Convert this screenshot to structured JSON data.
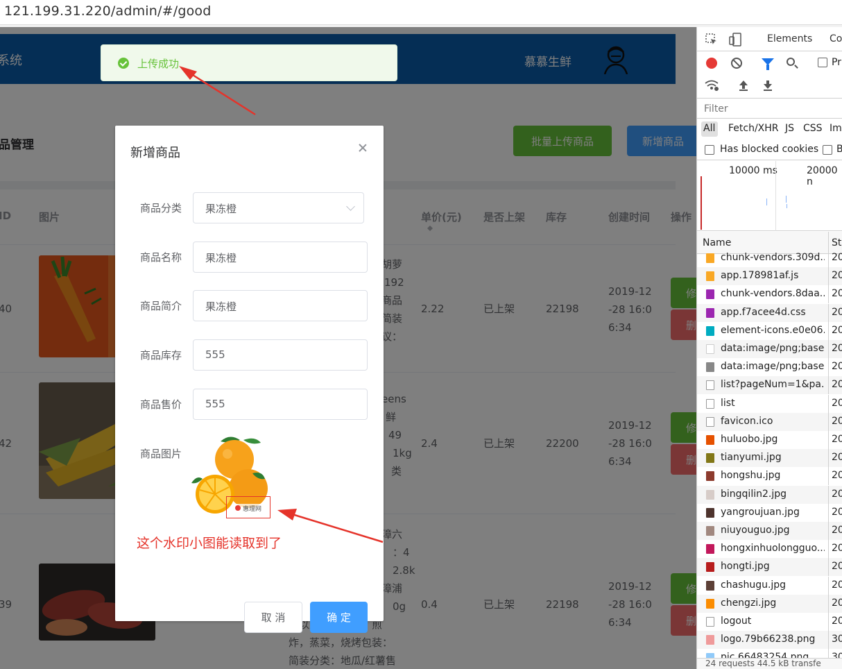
{
  "browser": {
    "url": "121.199.31.220/admin/#/good"
  },
  "header": {
    "system_partial": "系统",
    "username": "慕慕生鲜"
  },
  "toast": {
    "message": "上传成功"
  },
  "page": {
    "title_partial": "品管理",
    "batch_upload_label": "批量上传商品",
    "add_product_label": "新增商品"
  },
  "table": {
    "headers": [
      "ID",
      "图片",
      "单价(元)",
      "是否上架",
      "库存",
      "创建时间",
      "操作"
    ],
    "rows": [
      {
        "id": "40",
        "desc_lines": [
          "胡萝",
          "192",
          "商品",
          "简装",
          "议："
        ],
        "price": "2.22",
        "status": "已上架",
        "stock": "22198",
        "created": [
          "2019-12",
          "-28 16:0",
          "6:34"
        ],
        "edit": "修",
        "del": "删"
      },
      {
        "id": "42",
        "desc_lines": [
          "eens",
          "鲜",
          "49",
          "1kg",
          "类"
        ],
        "price": "2.4",
        "status": "已上架",
        "stock": "22200",
        "created": [
          "2019-12",
          "-28 16:0",
          "6:34"
        ],
        "edit": "修",
        "del": "删"
      },
      {
        "id": "39",
        "desc_lines": [
          "漳六",
          "：4",
          "2.8k",
          "漳浦",
          "0g",
          "及以上烹饪建议：煎",
          "炸，蒸菜，烧烤包装：",
          "简装分类：地瓜/红薯售"
        ],
        "price": "0.4",
        "status": "已上架",
        "stock": "22198",
        "created": [
          "2019-12",
          "-28 16:0",
          "6:34"
        ],
        "edit": "修",
        "del": "删"
      }
    ]
  },
  "dialog": {
    "title": "新增商品",
    "fields": [
      {
        "label": "商品分类",
        "value": "果冻橙"
      },
      {
        "label": "商品名称",
        "value": "果冻橙"
      },
      {
        "label": "商品简介",
        "value": "果冻橙"
      },
      {
        "label": "商品库存",
        "value": "555"
      },
      {
        "label": "商品售价",
        "value": "555"
      }
    ],
    "image_label": "商品图片",
    "watermark_text": "惠理网",
    "annotation": "这个水印小图能读取到了",
    "cancel_label": "取 消",
    "confirm_label": "确 定"
  },
  "devtools": {
    "tabs": [
      "Elements",
      "Co"
    ],
    "checkbox_pr": "Pr",
    "filter_placeholder": "Filter",
    "types": [
      "All",
      "Fetch/XHR",
      "JS",
      "CSS",
      "Im"
    ],
    "has_blocked": "Has blocked cookies",
    "blocked_b": "B",
    "timeline_labels": [
      "10000 ms",
      "20000 n"
    ],
    "col_name": "Name",
    "col_status": "Sta",
    "requests": [
      {
        "name": "chunk-vendors.309d...",
        "status": "20",
        "color": "#f9a825"
      },
      {
        "name": "app.178981af.js",
        "status": "20",
        "color": "#f9a825"
      },
      {
        "name": "chunk-vendors.8daa...",
        "status": "20",
        "color": "#9c27b0"
      },
      {
        "name": "app.f7acee4d.css",
        "status": "20",
        "color": "#9c27b0"
      },
      {
        "name": "element-icons.e0e06...",
        "status": "20",
        "color": "#00acc1"
      },
      {
        "name": "data:image/png;base...",
        "status": "20",
        "color": "#cccccc"
      },
      {
        "name": "data:image/png;base...",
        "status": "20",
        "color": "#888888"
      },
      {
        "name": "list?pageNum=1&pa...",
        "status": "20",
        "color": "#999999"
      },
      {
        "name": "list",
        "status": "20",
        "color": "#999999"
      },
      {
        "name": "favicon.ico",
        "status": "20",
        "color": "#999999"
      },
      {
        "name": "huluobo.jpg",
        "status": "20",
        "color": "#e65100"
      },
      {
        "name": "tianyumi.jpg",
        "status": "20",
        "color": "#827717"
      },
      {
        "name": "hongshu.jpg",
        "status": "20",
        "color": "#8d3b2e"
      },
      {
        "name": "bingqilin2.jpg",
        "status": "20",
        "color": "#d7ccc8"
      },
      {
        "name": "yangroujuan.jpg",
        "status": "20",
        "color": "#4e342e"
      },
      {
        "name": "niuyouguo.jpg",
        "status": "20",
        "color": "#a1887f"
      },
      {
        "name": "hongxinhuolongguo....",
        "status": "20",
        "color": "#c2185b"
      },
      {
        "name": "hongti.jpg",
        "status": "20",
        "color": "#b71c1c"
      },
      {
        "name": "chashugu.jpg",
        "status": "20",
        "color": "#5d4037"
      },
      {
        "name": "chengzi.jpg",
        "status": "20",
        "color": "#fb8c00"
      },
      {
        "name": "logout",
        "status": "20",
        "color": "#999999"
      },
      {
        "name": "logo.79b66238.png",
        "status": "30",
        "color": "#ef9a9a"
      },
      {
        "name": "pic.66483254.png",
        "status": "30",
        "color": "#90caf9"
      }
    ],
    "footer": "24 requests   44.5 kB transfe"
  }
}
